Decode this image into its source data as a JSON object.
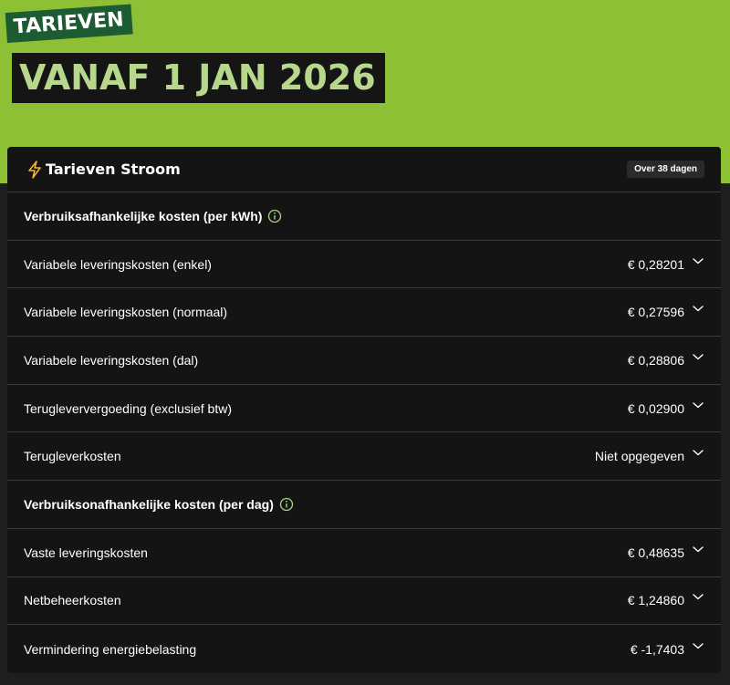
{
  "hero": {
    "tag": "TARIEVEN",
    "title": "VANAF 1 JAN 2026"
  },
  "card": {
    "title": "Tarieven Stroom",
    "badge": "Over 38 dagen",
    "icon": "lightning-bolt-icon",
    "accent": "#f2b233"
  },
  "sections": [
    {
      "label": "Verbruiksafhankelijke kosten (per kWh)",
      "rows": [
        {
          "label": "Variabele leveringskosten (enkel)",
          "value": "€ 0,28201"
        },
        {
          "label": "Variabele leveringskosten (normaal)",
          "value": "€ 0,27596"
        },
        {
          "label": "Variabele leveringskosten (dal)",
          "value": "€ 0,28806"
        },
        {
          "label": "Terugleververgoeding (exclusief btw)",
          "value": "€ 0,02900"
        },
        {
          "label": "Terugleverkosten",
          "value": "Niet opgegeven"
        }
      ]
    },
    {
      "label": "Verbruiksonafhankelijke kosten (per dag)",
      "rows": [
        {
          "label": "Vaste leveringskosten",
          "value": "€ 0,48635"
        },
        {
          "label": "Netbeheerkosten",
          "value": "€ 1,24860"
        },
        {
          "label": "Vermindering energiebelasting",
          "value": "€ -1,7403"
        }
      ]
    }
  ],
  "colors": {
    "hero_green": "#8dc034",
    "tag_green": "#1d5b33",
    "title_text": "#b7d78c",
    "card_bg": "#141414",
    "info_icon": "#a8d58a"
  }
}
